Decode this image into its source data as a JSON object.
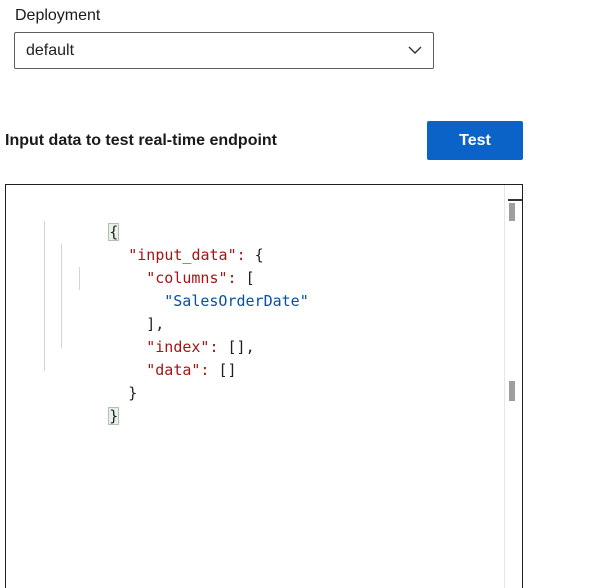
{
  "deployment": {
    "label": "Deployment",
    "selected": "default",
    "chevron_icon": "chevron-down-icon"
  },
  "test_section": {
    "title": "Input data to test real-time endpoint",
    "button_label": "Test",
    "button_color": "#0b63c7"
  },
  "editor": {
    "lines": [
      "{",
      "\"input_data\":",
      " {",
      "\"columns\":",
      " [",
      "\"SalesOrderDate\"",
      "],",
      "\"index\":",
      " [],",
      "\"data\":",
      " []",
      "}",
      "}"
    ],
    "colors": {
      "key": "#a31515",
      "string": "#0451a5",
      "punctuation": "#1f1f1f"
    }
  }
}
